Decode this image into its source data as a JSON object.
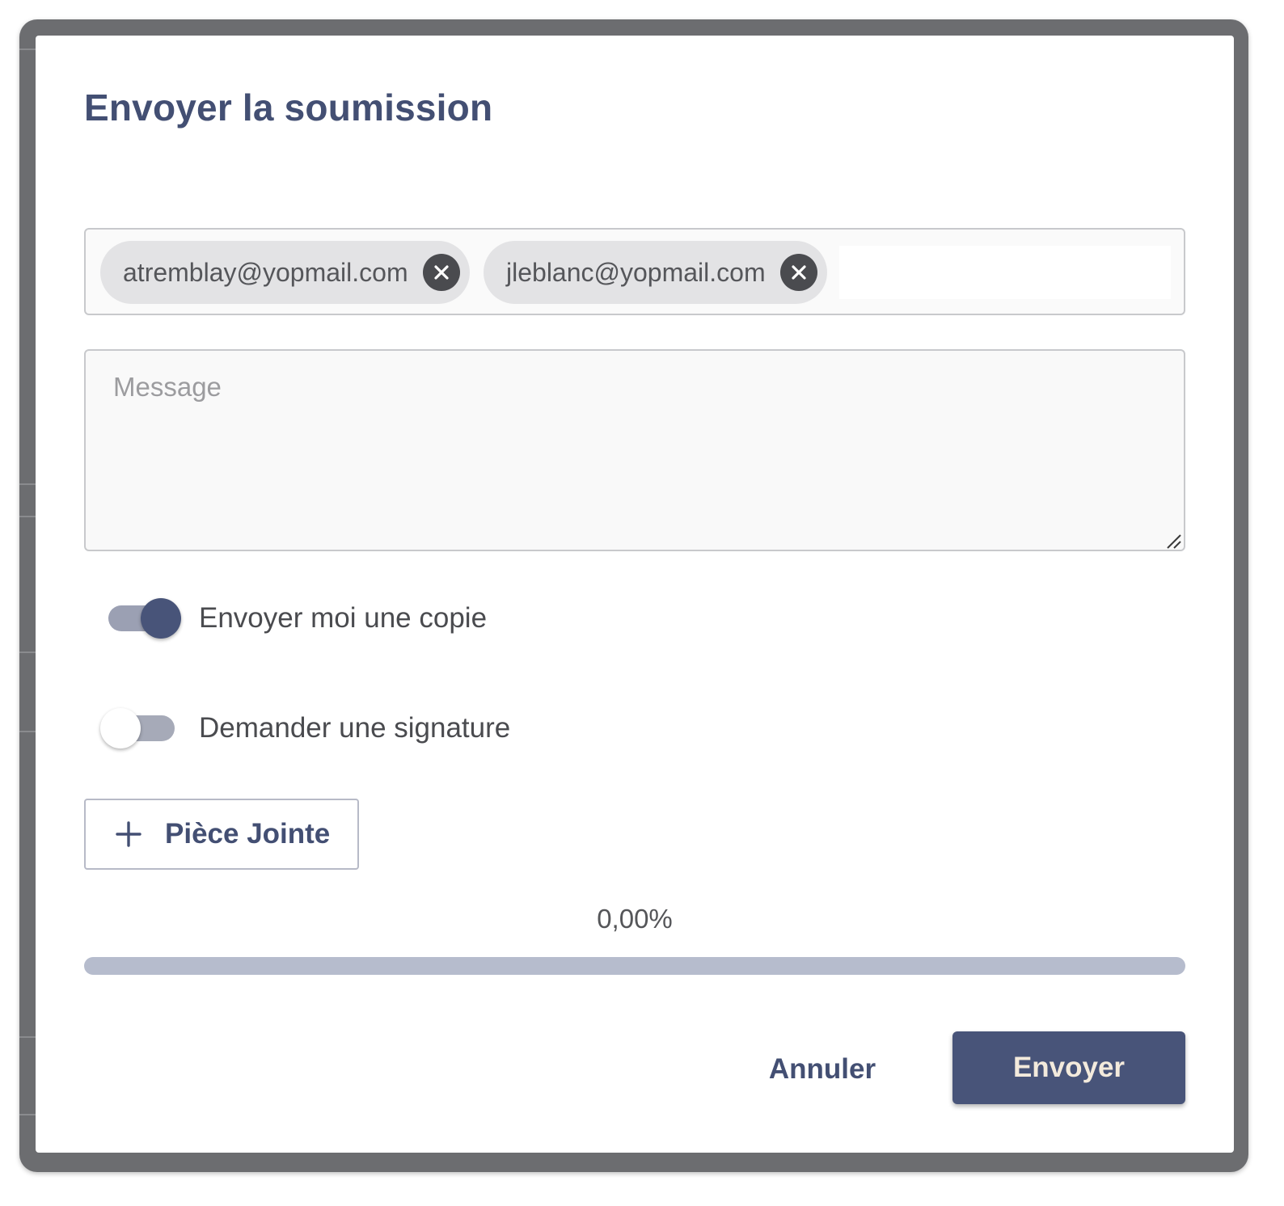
{
  "dialog": {
    "title": "Envoyer la soumission"
  },
  "recipients": [
    {
      "email": "atremblay@yopmail.com"
    },
    {
      "email": "jleblanc@yopmail.com"
    }
  ],
  "message": {
    "placeholder": "Message",
    "value": ""
  },
  "toggles": {
    "copy": {
      "label": "Envoyer moi une copie",
      "checked": true
    },
    "signature": {
      "label": "Demander une signature",
      "checked": false
    }
  },
  "attachment": {
    "label": "Pièce Jointe",
    "icon": "plus-icon"
  },
  "progress": {
    "label": "0,00%",
    "fraction": 0.0
  },
  "actions": {
    "cancel_label": "Annuler",
    "send_label": "Envoyer"
  },
  "colors": {
    "accent": "#434f73",
    "toggle_track_on": "#9ba0b3",
    "toggle_knob_on": "#485479",
    "toggle_track_off": "#a6aab8",
    "progress_track": "#b6bccd",
    "send_text": "#f3eadc"
  }
}
